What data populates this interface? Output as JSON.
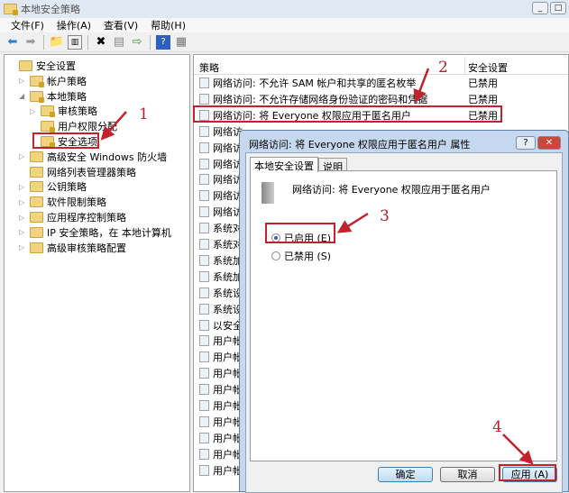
{
  "window": {
    "title": "本地安全策略",
    "min": "_",
    "max": "□"
  },
  "menu": [
    "文件(F)",
    "操作(A)",
    "查看(V)",
    "帮助(H)"
  ],
  "toolbar": [
    "back-icon",
    "forward-icon",
    "up-folder-icon",
    "show-tree-icon",
    "delete-icon",
    "properties-icon",
    "export-icon",
    "help-icon",
    "view-icon"
  ],
  "tree": [
    {
      "label": "安全设置",
      "level": 0,
      "exp": ""
    },
    {
      "label": "帐户策略",
      "level": 1,
      "exp": "▷"
    },
    {
      "label": "本地策略",
      "level": 1,
      "exp": "◢"
    },
    {
      "label": "审核策略",
      "level": 2,
      "exp": "▷"
    },
    {
      "label": "用户权限分配",
      "level": 2,
      "exp": ""
    },
    {
      "label": "安全选项",
      "level": 2,
      "exp": "",
      "selected": true
    },
    {
      "label": "高级安全 Windows 防火墙",
      "level": 1,
      "exp": "▷"
    },
    {
      "label": "网络列表管理器策略",
      "level": 1,
      "exp": ""
    },
    {
      "label": "公钥策略",
      "level": 1,
      "exp": "▷"
    },
    {
      "label": "软件限制策略",
      "level": 1,
      "exp": "▷"
    },
    {
      "label": "应用程序控制策略",
      "level": 1,
      "exp": "▷"
    },
    {
      "label": "IP 安全策略，在 本地计算机",
      "level": 1,
      "exp": "▷"
    },
    {
      "label": "高级审核策略配置",
      "level": 1,
      "exp": "▷"
    }
  ],
  "list": {
    "headers": {
      "policy": "策略",
      "setting": "安全设置"
    },
    "rows": [
      {
        "p": "网络访问: 不允许 SAM 帐户和共享的匿名枚举",
        "v": "已禁用"
      },
      {
        "p": "网络访问: 不允许存储网络身份验证的密码和凭据",
        "v": "已禁用"
      },
      {
        "p": "网络访问: 将 Everyone 权限应用于匿名用户",
        "v": "已禁用"
      },
      {
        "p": "网络访",
        "v": ""
      },
      {
        "p": "网络访",
        "v": ""
      },
      {
        "p": "网络访",
        "v": ""
      },
      {
        "p": "网络访",
        "v": ""
      },
      {
        "p": "网络访",
        "v": ""
      },
      {
        "p": "网络访",
        "v": ""
      },
      {
        "p": "系统对",
        "v": ""
      },
      {
        "p": "系统对",
        "v": ""
      },
      {
        "p": "系统加",
        "v": ""
      },
      {
        "p": "系统加",
        "v": ""
      },
      {
        "p": "系统设",
        "v": ""
      },
      {
        "p": "系统设",
        "v": ""
      },
      {
        "p": "以安全",
        "v": ""
      },
      {
        "p": "用户帐",
        "v": ""
      },
      {
        "p": "用户帐",
        "v": ""
      },
      {
        "p": "用户帐",
        "v": ""
      },
      {
        "p": "用户帐",
        "v": ""
      },
      {
        "p": "用户帐",
        "v": ""
      },
      {
        "p": "用户帐",
        "v": ""
      },
      {
        "p": "用户帐",
        "v": ""
      },
      {
        "p": "用户帐",
        "v": ""
      },
      {
        "p": "用户帐",
        "v": ""
      }
    ]
  },
  "dialog": {
    "title": "网络访问: 将 Everyone 权限应用于匿名用户 属性",
    "help": "?",
    "close": "✕",
    "tabs": [
      "本地安全设置",
      "说明"
    ],
    "policy_name": "网络访问: 将 Everyone 权限应用于匿名用户",
    "enabled_label": "已启用 (E)",
    "disabled_label": "已禁用 (S)",
    "selected": "enabled",
    "ok": "确定",
    "cancel": "取消",
    "apply": "应用 (A)"
  },
  "annotations": [
    "1",
    "2",
    "3",
    "4"
  ],
  "colors": {
    "annotation": "#c2222c"
  }
}
